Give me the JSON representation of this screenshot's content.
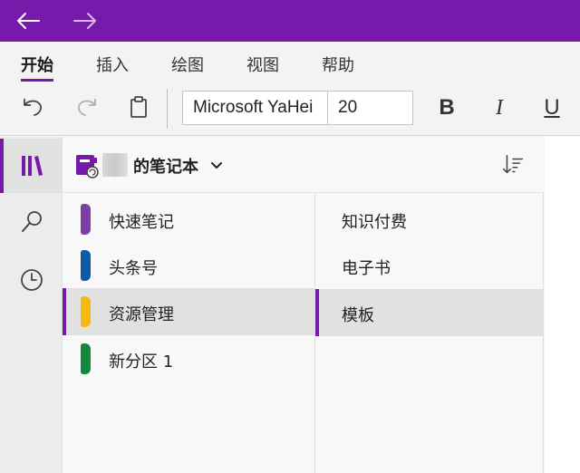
{
  "titlebar": {
    "color": "#7719aa",
    "back_icon": "arrow-left-icon",
    "forward_icon": "arrow-right-icon"
  },
  "ribbon": {
    "tabs": [
      {
        "label": "开始",
        "active": true
      },
      {
        "label": "插入",
        "active": false
      },
      {
        "label": "绘图",
        "active": false
      },
      {
        "label": "视图",
        "active": false
      },
      {
        "label": "帮助",
        "active": false
      }
    ],
    "toolbar": {
      "undo_icon": "undo-icon",
      "redo_icon": "redo-icon",
      "clipboard_icon": "clipboard-icon",
      "font_name": "Microsoft YaHei",
      "font_size": "20",
      "bold_label": "B",
      "italic_label": "I",
      "underline_label": "U"
    }
  },
  "rail": {
    "items": [
      {
        "icon": "notebooks-icon",
        "active": true
      },
      {
        "icon": "search-icon",
        "active": false
      },
      {
        "icon": "recent-clock-icon",
        "active": false
      }
    ]
  },
  "notebook": {
    "title": "的笔记本",
    "icon": "notebook-icon",
    "sort_icon": "sort-icon"
  },
  "sections": [
    {
      "label": "快速笔记",
      "color": "#7d3fa3",
      "selected": false
    },
    {
      "label": "头条号",
      "color": "#0f5aa7",
      "selected": false
    },
    {
      "label": "资源管理",
      "color": "#f5b90f",
      "selected": true
    },
    {
      "label": "新分区 1",
      "color": "#0f8a3c",
      "selected": false
    }
  ],
  "pages": [
    {
      "label": "知识付费",
      "selected": false
    },
    {
      "label": "电子书",
      "selected": false
    },
    {
      "label": "模板",
      "selected": true
    }
  ]
}
